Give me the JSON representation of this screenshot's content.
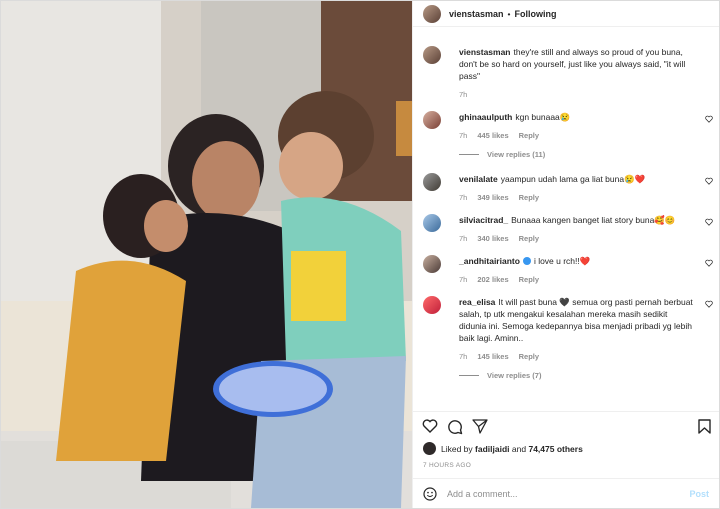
{
  "post": {
    "author": "vienstasman",
    "separator": "•",
    "follow_label": "Following"
  },
  "caption": {
    "user": "vienstasman",
    "text": "they're still and always so proud of you buna, don't be so hard on yourself, just like you always said, \"it will pass\"",
    "time": "7h"
  },
  "comments": [
    {
      "user": "ghinaaulputh",
      "text": "kgn bunaaa😢",
      "time": "7h",
      "likes": "445 likes",
      "reply": "Reply",
      "replies": "View replies (11)",
      "verified": false
    },
    {
      "user": "venilalate",
      "text": "yaampun udah lama ga liat buna😢❤️",
      "time": "7h",
      "likes": "349 likes",
      "reply": "Reply",
      "replies": "",
      "verified": false
    },
    {
      "user": "silviacitrad_",
      "text": "Bunaaa kangen banget liat story buna🥰😊",
      "time": "7h",
      "likes": "340 likes",
      "reply": "Reply",
      "replies": "",
      "verified": false
    },
    {
      "user": "_andhitairianto",
      "text": "i love u rch!!❤️",
      "time": "7h",
      "likes": "202 likes",
      "reply": "Reply",
      "replies": "",
      "verified": true
    },
    {
      "user": "rea_elisa",
      "text": "It will past buna 🖤 semua org pasti pernah berbuat salah, tp utk mengakui kesalahan mereka masih sedikit didunia ini. Semoga kedepannya bisa menjadi pribadi yg lebih baik lagi. Aminn..",
      "time": "7h",
      "likes": "145 likes",
      "reply": "Reply",
      "replies": "View replies (7)",
      "verified": false
    }
  ],
  "likes": {
    "prefix": "Liked by",
    "user": "fadiljaidi",
    "and": "and",
    "count": "74,475 others"
  },
  "timestamp": "7 HOURS AGO",
  "add_comment": {
    "placeholder": "Add a comment...",
    "post_label": "Post"
  },
  "colors": {
    "link": "#3897f0",
    "muted": "#8e8e8e",
    "post_disabled": "#b2dffc"
  }
}
